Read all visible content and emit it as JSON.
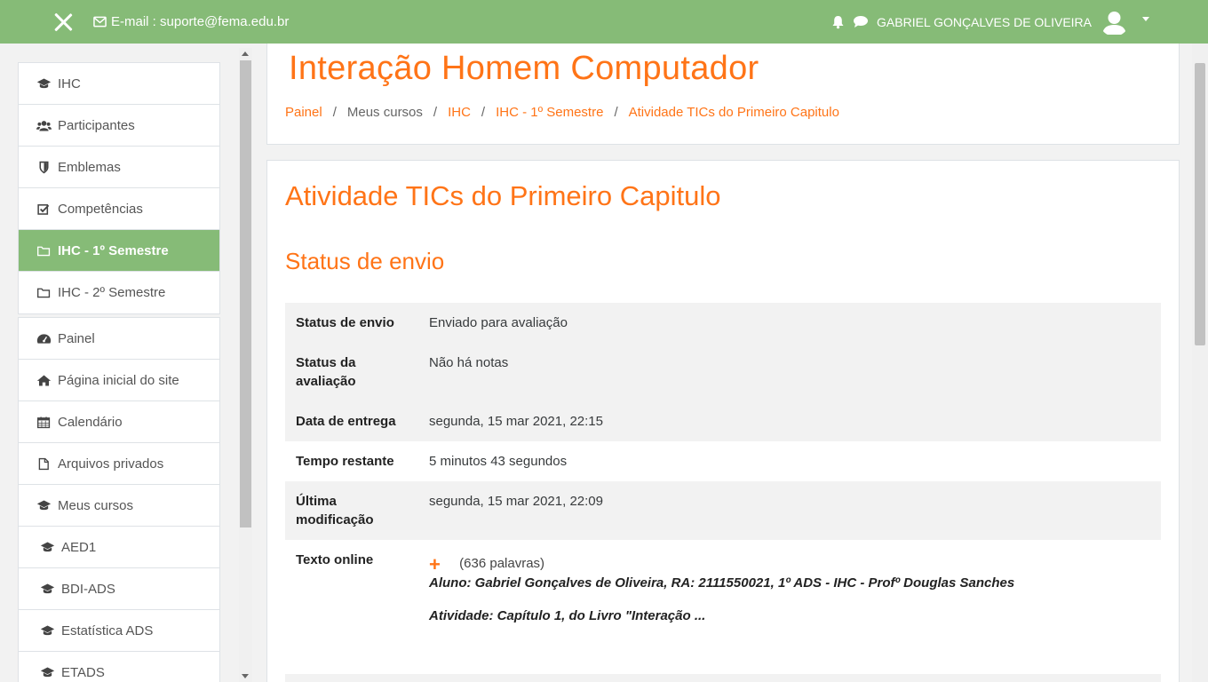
{
  "navbar": {
    "email_text": "E-mail : suporte@fema.edu.br",
    "user_name": "GABRIEL GONÇALVES DE OLIVEIRA"
  },
  "sidebar": {
    "group1": [
      {
        "label": "IHC",
        "icon": "graduation-cap-icon",
        "active": false
      },
      {
        "label": "Participantes",
        "icon": "users-icon",
        "active": false
      },
      {
        "label": "Emblemas",
        "icon": "shield-icon",
        "active": false
      },
      {
        "label": "Competências",
        "icon": "checkbox-icon",
        "active": false
      },
      {
        "label": "IHC - 1º Semestre",
        "icon": "folder-icon",
        "active": true
      },
      {
        "label": "IHC - 2º Semestre",
        "icon": "folder-icon",
        "active": false
      }
    ],
    "group2": [
      {
        "label": "Painel",
        "icon": "dashboard-icon"
      },
      {
        "label": "Página inicial do site",
        "icon": "home-icon"
      },
      {
        "label": "Calendário",
        "icon": "calendar-icon"
      },
      {
        "label": "Arquivos privados",
        "icon": "file-icon"
      },
      {
        "label": "Meus cursos",
        "icon": "graduation-cap-icon"
      },
      {
        "label": "AED1",
        "icon": "graduation-cap-icon"
      },
      {
        "label": "BDI-ADS",
        "icon": "graduation-cap-icon"
      },
      {
        "label": "Estatística ADS",
        "icon": "graduation-cap-icon"
      },
      {
        "label": "ETADS",
        "icon": "graduation-cap-icon"
      }
    ]
  },
  "header": {
    "title": "Interação Homem Computador",
    "breadcrumb": [
      "Painel",
      "Meus cursos",
      "IHC",
      "IHC - 1º Semestre",
      "Atividade TICs do Primeiro Capitulo"
    ]
  },
  "content": {
    "title": "Atividade TICs do Primeiro Capitulo",
    "section_title": "Status de envio",
    "rows": [
      {
        "label": "Status de envio",
        "value": "Enviado para avaliação"
      },
      {
        "label": "Status da avaliação",
        "value": "Não há notas"
      },
      {
        "label": "Data de entrega",
        "value": "segunda, 15 mar 2021, 22:15"
      },
      {
        "label": "Tempo restante",
        "value": "5 minutos 43 segundos"
      },
      {
        "label": "Última modificação",
        "value": "segunda, 15 mar 2021, 22:09"
      }
    ],
    "online_text": {
      "label": "Texto online",
      "expand_symbol": "+",
      "word_count": "(636 palavras)",
      "line1": "Aluno: Gabriel Gonçalves de Oliveira, RA: 2111550021, 1º ADS - IHC - Profº Douglas Sanches",
      "line2": "Atividade: Capítulo 1, do Livro \"Interação ..."
    }
  },
  "colors": {
    "brand_green": "#86bb77",
    "accent_orange": "#ff7417"
  }
}
